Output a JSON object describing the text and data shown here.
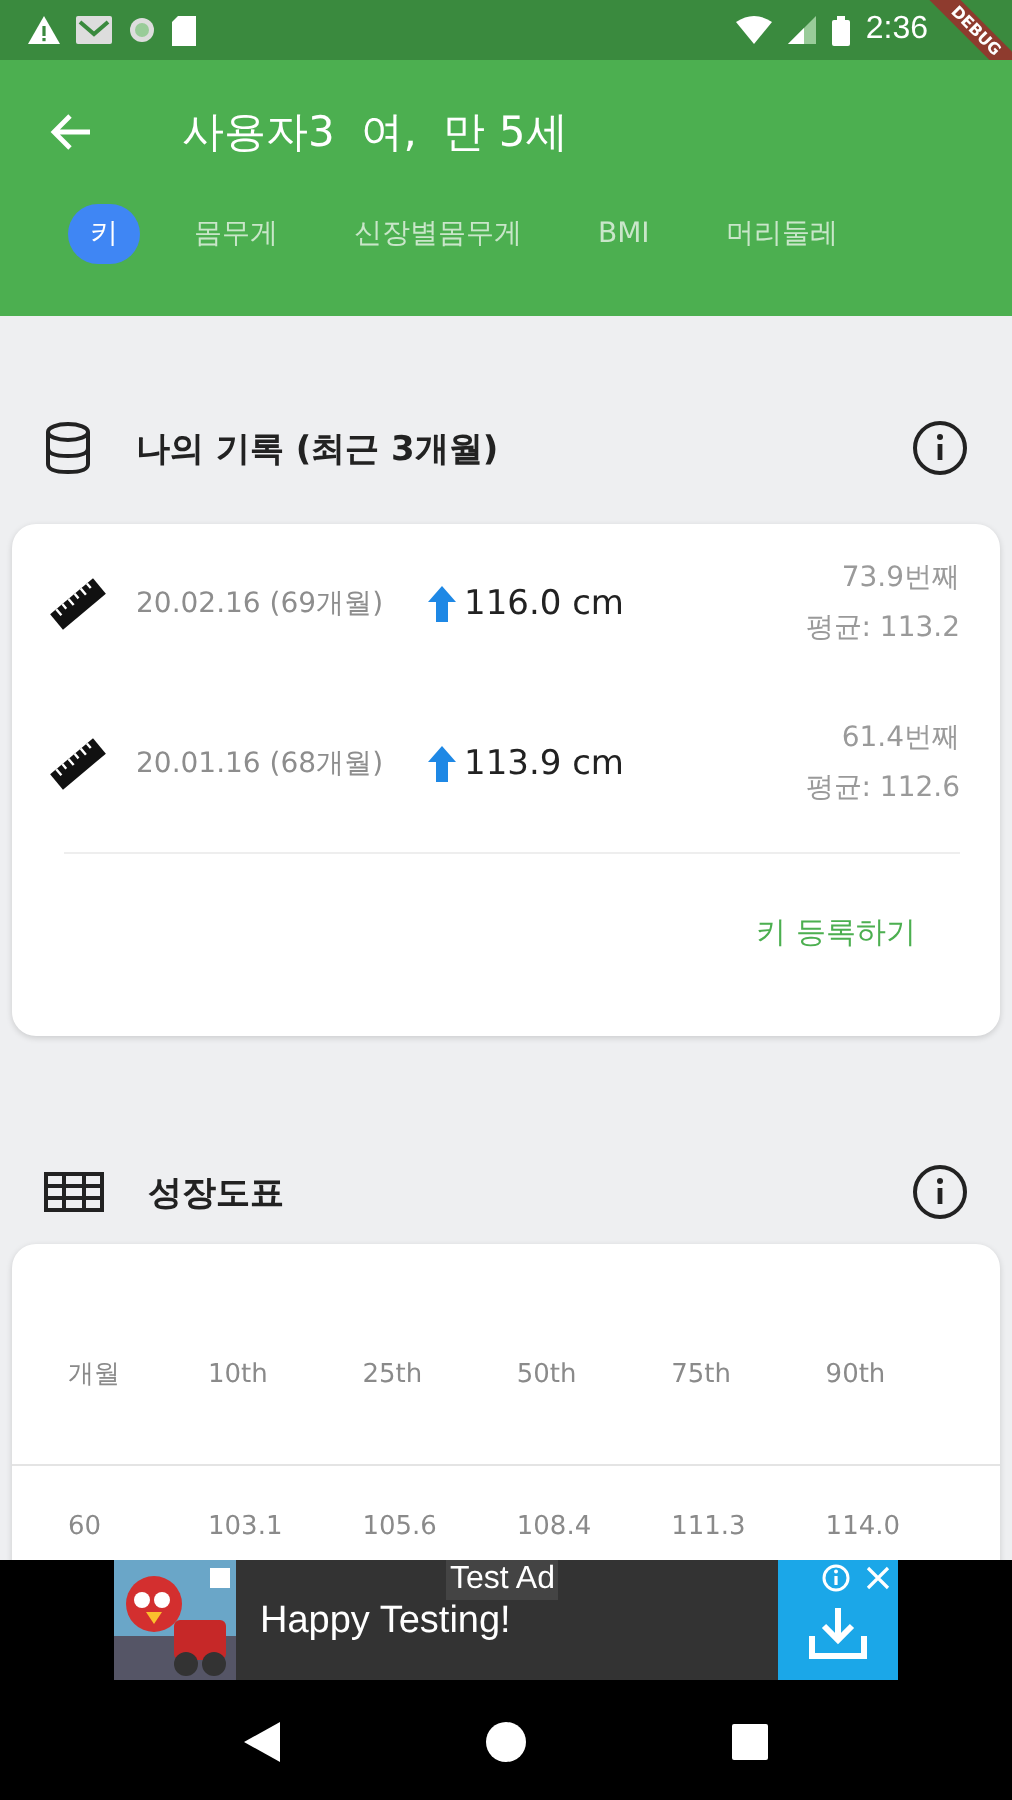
{
  "status_bar": {
    "time": "2:36"
  },
  "debug_banner": "DEBUG",
  "app_bar": {
    "title": "사용자3  여,  만 5세"
  },
  "tabs": [
    {
      "label": "키",
      "selected": true
    },
    {
      "label": "몸무게",
      "selected": false
    },
    {
      "label": "신장별몸무게",
      "selected": false
    },
    {
      "label": "BMI",
      "selected": false
    },
    {
      "label": "머리둘레",
      "selected": false
    }
  ],
  "records_section": {
    "title": "나의 기록 (최근 3개월)",
    "records": [
      {
        "date": "20.02.16 (69개월)",
        "value": "116.0 cm",
        "rank": "73.9번째",
        "average": "평균: 113.2"
      },
      {
        "date": "20.01.16 (68개월)",
        "value": "113.9 cm",
        "rank": "61.4번째",
        "average": "평균: 112.6"
      }
    ],
    "action": "키 등록하기"
  },
  "chart_section": {
    "title": "성장도표",
    "table": {
      "columns": [
        "개월",
        "10th",
        "25th",
        "50th",
        "75th",
        "90th"
      ],
      "rows": [
        [
          "60",
          "103.1",
          "105.6",
          "108.4",
          "111.3",
          "114.0"
        ]
      ]
    }
  },
  "ad": {
    "label": "Test Ad",
    "text": "Happy Testing!"
  }
}
